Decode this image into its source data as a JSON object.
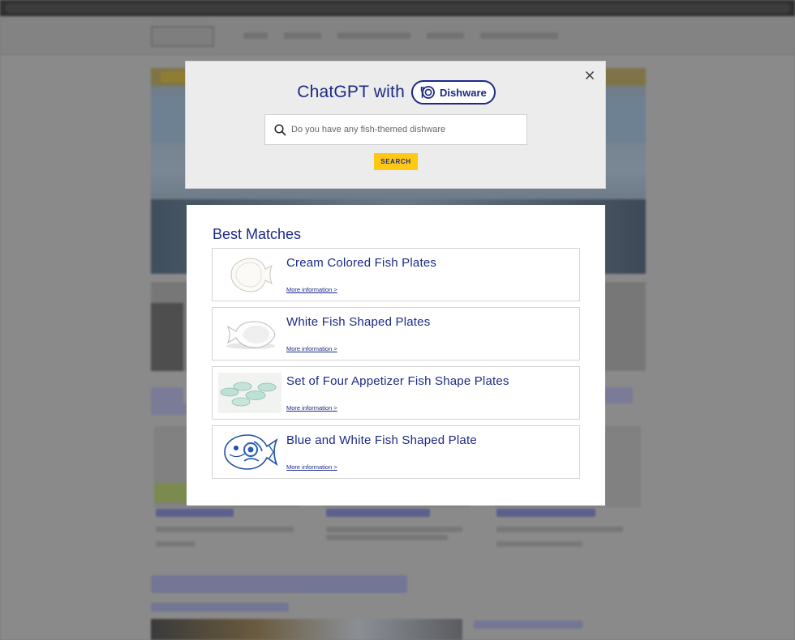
{
  "modal": {
    "brand_prefix": "ChatGPT with",
    "brand_name": "Dishware",
    "search_placeholder": "Do you have any fish-themed dishware",
    "search_button": "SEARCH"
  },
  "results": {
    "heading": "Best Matches",
    "items": [
      {
        "title": "Cream Colored Fish Plates",
        "link": "More information >",
        "image": "cream-fish-plate-image"
      },
      {
        "title": "White Fish Shaped Plates",
        "link": "More information >",
        "image": "white-fish-plate-image"
      },
      {
        "title": "Set of Four Appetizer Fish Shape Plates",
        "link": "More information >",
        "image": "green-fish-plates-set-image"
      },
      {
        "title": "Blue and White Fish Shaped Plate",
        "link": "More information >",
        "image": "blue-white-fish-plate-image"
      }
    ]
  },
  "colors": {
    "brand_navy": "#1c2a86",
    "button_yellow": "#ffc814",
    "overlay_gray": "#8a8a8a"
  }
}
